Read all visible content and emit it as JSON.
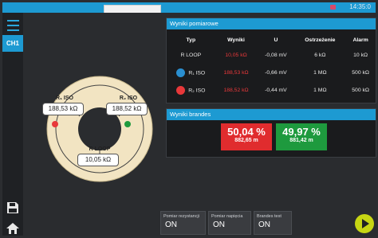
{
  "status": {
    "time": "14:35:0"
  },
  "sidebar": {
    "channel_label": "CH1"
  },
  "meas_panel": {
    "title": "Wyniki pomiarowe",
    "columns": [
      "Typ",
      "Wyniki",
      "U",
      "Ostrzeżenie",
      "Alarm"
    ],
    "rows": [
      {
        "type": "R LOOP",
        "result": "10,05 kΩ",
        "u": "-0,08 mV",
        "warning": "6 kΩ",
        "alarm": "10 kΩ"
      },
      {
        "type": "R₁ ISO",
        "result": "188,53 kΩ",
        "u": "-0,66 mV",
        "warning": "1 MΩ",
        "alarm": "500 kΩ"
      },
      {
        "type": "R₂ ISO",
        "result": "188,52 kΩ",
        "u": "-0,44 mV",
        "warning": "1 MΩ",
        "alarm": "500 kΩ"
      }
    ]
  },
  "diagram": {
    "r1_label": "R₁ ISO",
    "r1_value": "188,53 kΩ",
    "r2_label": "R₂ ISO",
    "r2_value": "188,52 kΩ",
    "loop_label": "R LOOP",
    "loop_value": "10,05 kΩ"
  },
  "brand_panel": {
    "title": "Wyniki brandes",
    "red_percent": "50,04 %",
    "red_distance": "882,65 m",
    "green_percent": "49,97 %",
    "green_distance": "881,42 m"
  },
  "bottom_buttons": [
    {
      "label": "Pomiar rezystancji",
      "value": "ON"
    },
    {
      "label": "Pomiar napięcia",
      "value": "ON"
    },
    {
      "label": "Brandes test",
      "value": "ON"
    }
  ],
  "colors": {
    "accent": "#1d9ad2",
    "red": "#e8383a",
    "green": "#1e9a3e",
    "play": "#c7d613"
  },
  "icons": {
    "menu": "hamburger-icon",
    "save": "save-icon",
    "home": "home-icon",
    "play": "play-icon"
  }
}
